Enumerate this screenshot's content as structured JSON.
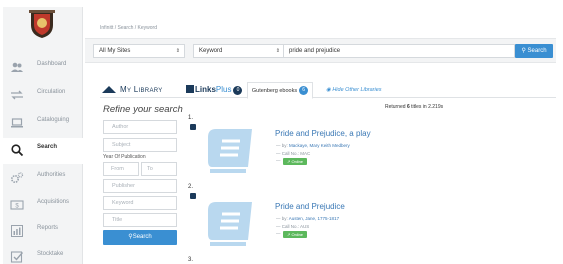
{
  "sidebar": {
    "logo_icon": "crest-logo",
    "items": [
      {
        "label": "Dashboard",
        "icon": "users-icon"
      },
      {
        "label": "Circulation",
        "icon": "swap-icon"
      },
      {
        "label": "Cataloguing",
        "icon": "laptop-icon"
      },
      {
        "label": "Search",
        "icon": "search-icon"
      },
      {
        "label": "Authorities",
        "icon": "cogs-icon"
      },
      {
        "label": "Acquisitions",
        "icon": "dollar-icon"
      },
      {
        "label": "Reports",
        "icon": "chart-icon"
      },
      {
        "label": "Stocktake",
        "icon": "checkbox-icon"
      }
    ],
    "active": "Search"
  },
  "breadcrumb": "Infinitt / Search / Keyword",
  "search": {
    "site_value": "All My Sites",
    "field_value": "Keyword",
    "query_value": "pride and prejudice",
    "button_label": "Search"
  },
  "tabs": {
    "mylib": "My Library",
    "links_a": "Links",
    "links_b": "Plus",
    "links_count": "0",
    "gutenberg": "Gutenberg ebooks",
    "gutenberg_count": "6",
    "hide": "Hide Other Libraries"
  },
  "refine": {
    "title": "Refine your search",
    "author_placeholder": "Author",
    "subject_placeholder": "Subject",
    "yop_label": "Year Of Publication",
    "from_placeholder": "From",
    "to_placeholder": "To",
    "publisher_placeholder": "Publisher",
    "keyword_placeholder": "Keyword",
    "title_placeholder": "Title",
    "button_label": "Search"
  },
  "results": {
    "returned_prefix": "Returned ",
    "returned_count": "6",
    "returned_suffix": " titles in 2.219s",
    "items": [
      {
        "num": "1.",
        "title": "Pride and Prejudice, a play",
        "by_prefix": "by: ",
        "by": "Mackaye, Mary Keith Medbery",
        "callno": "Call No.: MAC",
        "online": "Online"
      },
      {
        "num": "2.",
        "title": "Pride and Prejudice",
        "by_prefix": "by: ",
        "by": "Austen, Jane, 1775-1817",
        "callno": "Call No.: AUS",
        "online": "Online"
      }
    ],
    "third_num": "3."
  },
  "colors": {
    "accent": "#3a8fd2",
    "navy": "#1b3a5a",
    "online": "#5cb85c",
    "book_cover": "#b9d8ef"
  }
}
